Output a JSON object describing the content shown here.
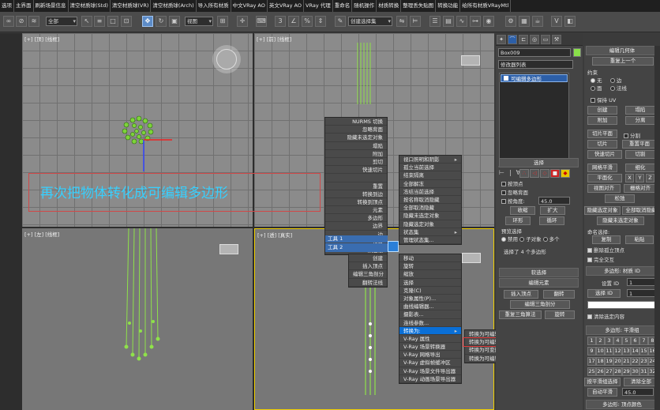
{
  "tabbar": {
    "tabs": [
      "选项",
      "主界面",
      "刷新场景信息",
      "清空材质球(Std)",
      "清空材质球(VR)",
      "清空材质球(Arch)",
      "导入所有材质",
      "中文VRay AO",
      "英文VRay AO",
      "VRay 代理",
      "重命名",
      "随机操作",
      "材质转换",
      "整理丢失贴图",
      "转换功能",
      "给所有材质VRayMtl"
    ]
  },
  "toolbar": {
    "selection_filter": "全部",
    "ref_coord": "视图",
    "named_sel": "创建选择集"
  },
  "viewports": {
    "top_left": "[+] [顶] [线框]",
    "top_right": "[+] [前] [线框]",
    "bottom_left": "[+] [左] [线框]",
    "bottom_right": "[+] [透] [真实]"
  },
  "annotation": "再次把物体转化成可编辑多边形",
  "quad_menu": {
    "upper_left": [
      "NURMS 切换",
      "忽略背面",
      "隐藏未选定对象",
      "塌陷",
      "附加",
      "剪切",
      "快速切片",
      "",
      "重置",
      "转换到边",
      "转换到顶点",
      "元素",
      "多边形",
      "边界",
      "边",
      "顶点",
      "顶层级"
    ],
    "upper_left_labels": {
      "tools1": "工具 1",
      "tools2": "工具 2"
    },
    "upper_right": [
      "视口照明和阴影",
      "孤立当前选择",
      "结束隔离",
      "全部解冻",
      "冻结当前选择",
      "按名称取消隐藏",
      "全部取消隐藏",
      "隐藏未选定对象",
      "隐藏选定对象",
      "状态集",
      "管理状态集..."
    ],
    "upper_right_labels": {
      "display": "显示",
      "transform": "变换"
    },
    "lower_left": [
      "创建",
      "插入顶点",
      "编辑三角剖分",
      "翻转法线"
    ],
    "lower_right": [
      "移动",
      "旋转",
      "缩放",
      "选择",
      "克隆(C)",
      "对象属性(P)...",
      "曲线编辑器...",
      "摄影表...",
      "连线参数...",
      "转换为:",
      "V-Ray 属性",
      "V-Ray 场景转换器",
      "V-Ray 网格导出",
      "V-Ray 虚拟帧缓冲区",
      "V-Ray 场景文件导出器",
      "V-Ray 动画场景导出器"
    ],
    "submenu": [
      "转换为可编辑网格",
      "转换为可编辑多边形",
      "转换为可变形 gPoly",
      "转换为可编辑面片"
    ],
    "highlight_index": 9,
    "sub_highlight_index": 1
  },
  "cmd_panel": {
    "object_name": "Box009",
    "color_swatch": "#8ae04a",
    "modifier_list": "修改器列表",
    "stack_item": "可编辑多边形",
    "selection_title": "选择",
    "by_vertex": "按顶点",
    "ignore_backfacing": "忽略背面",
    "by_angle": "按角度:",
    "angle_value": "45.0",
    "shrink": "收缩",
    "grow": "扩大",
    "ring": "环形",
    "loop": "循环",
    "preview_title": "预览选择",
    "preview_opts": [
      "禁用",
      "子对象",
      "多个"
    ],
    "selected_info": "选择了 4 个多边形",
    "soft_sel": "软选择",
    "edit_elements": "编辑元素",
    "insert_vertex": "插入顶点",
    "flip": "翻转",
    "edit_tri": "编辑三角剖分",
    "retriangulate": "重复三角算法",
    "turn": "旋转"
  },
  "edit_poly": {
    "title": "编辑几何体",
    "repeat_last": "重复上一个",
    "constraints": "约束",
    "c_opts": [
      "无",
      "边",
      "面",
      "法线"
    ],
    "preserve_uv": "保持 UV",
    "create": "创建",
    "collapse": "塌陷",
    "attach": "附加",
    "detach": "分离",
    "slice_plane": "切片平面",
    "split": "分割",
    "slice": "切片",
    "reset_plane": "重置平面",
    "quickslice": "快速切片",
    "cut": "切割",
    "msmooth": "网格平滑",
    "tessellate": "细化",
    "make_planar": "平面化",
    "xyz": [
      "X",
      "Y",
      "Z"
    ],
    "view_align": "视图对齐",
    "grid_align": "栅格对齐",
    "relax": "松弛",
    "hide_sel": "隐藏选定对象",
    "unhide_all": "全部取消隐藏",
    "hide_unsel": "隐藏未选定对象",
    "named_sel": "命名选择:",
    "copy": "复制",
    "paste": "粘贴",
    "delete_iso": "删除孤立顶点",
    "full_interact": "完全交互",
    "mat_title": "多边形: 材质 ID",
    "set_id": "设置 ID",
    "set_id_val": "1",
    "select_id": "选择 ID",
    "select_id_val": "1",
    "clear_sel": "清除选定内容",
    "sg_title": "多边形: 平滑组",
    "sg_nums": [
      "1",
      "2",
      "3",
      "4",
      "5",
      "6",
      "7",
      "8",
      "9",
      "10",
      "11",
      "12",
      "13",
      "14",
      "15",
      "16",
      "17",
      "18",
      "19",
      "20",
      "21",
      "22",
      "23",
      "24",
      "25",
      "26",
      "27",
      "28",
      "29",
      "30",
      "31",
      "32"
    ],
    "sel_by_sg": "按平滑组选择",
    "clear_all": "清除全部",
    "autosmooth": "自动平滑",
    "autosmooth_val": "45.0",
    "vc_title": "多边形: 顶点颜色"
  }
}
